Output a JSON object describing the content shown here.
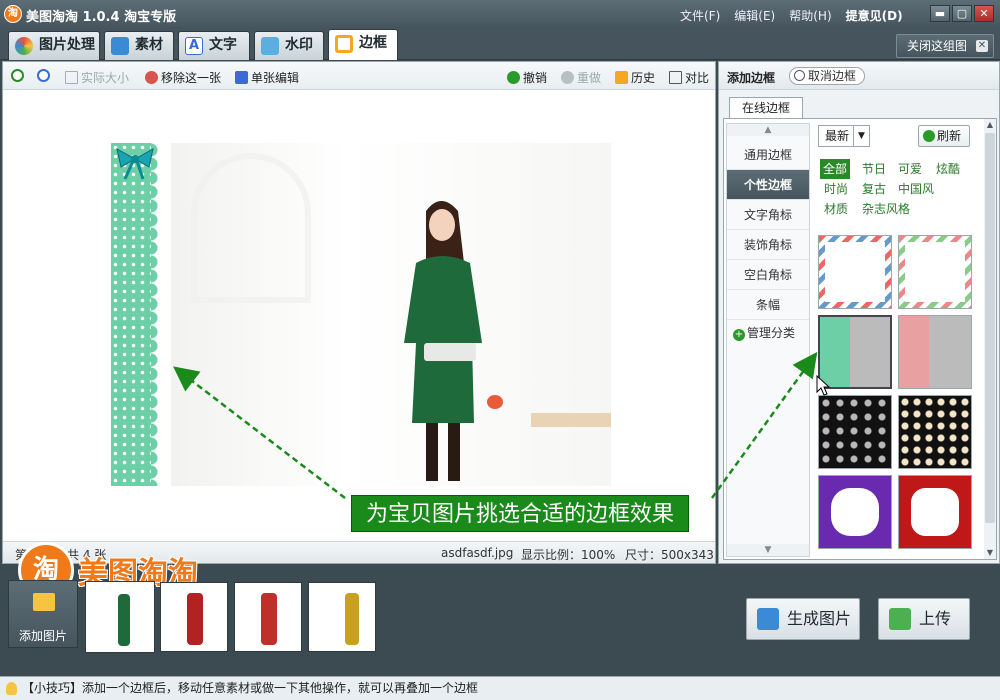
{
  "app": {
    "title": "美图淘淘 1.0.4 淘宝专版",
    "logo_char": "淘"
  },
  "menu": {
    "file": "文件(F)",
    "edit": "编辑(E)",
    "help": "帮助(H)",
    "feedback": "提意见(D)"
  },
  "window": {
    "minimize": "▬",
    "restore": "▢",
    "close": "✕"
  },
  "tabs": [
    {
      "label": "图片处理",
      "icon": "palette-icon",
      "color": "#e5533d"
    },
    {
      "label": "素材",
      "icon": "material-icon",
      "color": "#3a8ad6"
    },
    {
      "label": "文字",
      "icon": "text-icon",
      "color": "#3a6ad6"
    },
    {
      "label": "水印",
      "icon": "watermark-icon",
      "color": "#3a8ad6"
    },
    {
      "label": "边框",
      "icon": "border-icon",
      "color": "#f5a623"
    }
  ],
  "close_group": {
    "label": "关闭这组图",
    "x": "✕"
  },
  "toolbar": {
    "actual_size": "实际大小",
    "remove": "移除这一张",
    "single_edit": "单张编辑",
    "undo": "撤销",
    "redo": "重做",
    "history": "历史",
    "compare": "对比"
  },
  "callout": "为宝贝图片挑选合适的边框效果",
  "status": {
    "page": "第",
    "total": "共 4 张",
    "filename": "asdfasdf.jpg",
    "zoom": "显示比例：100%",
    "size": "尺寸：500x343"
  },
  "right_panel": {
    "title": "添加边框",
    "cancel": "取消边框",
    "online_tab": "在线边框",
    "categories": [
      "通用边框",
      "个性边框",
      "文字角标",
      "装饰角标",
      "空白角标",
      "条幅"
    ],
    "selected_category": 1,
    "manage": "管理分类",
    "sort": "最新",
    "refresh": "刷新",
    "tags": [
      "全部",
      "节日",
      "可爱",
      "炫酷",
      "时尚",
      "复古",
      "中国风",
      "材质",
      "杂志风格"
    ]
  },
  "bottom": {
    "add_photo": "添加图片",
    "brand": "美图淘淘",
    "brand_char": "淘"
  },
  "actions": {
    "generate": "生成图片",
    "upload": "上传"
  },
  "tip": "【小技巧】添加一个边框后，移动任意素材或做一下其他操作，就可以再叠加一个边框",
  "colors": {
    "accent_green": "#1a8a1a",
    "brand_orange": "#f07a1a",
    "border_mint": "#6dcfa6"
  }
}
